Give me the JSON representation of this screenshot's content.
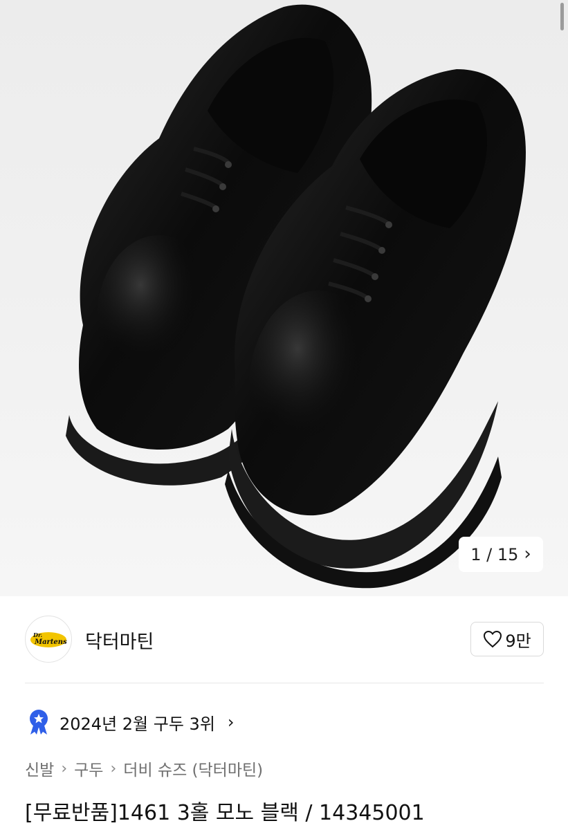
{
  "gallery": {
    "current": "1",
    "total": "15",
    "counter_text": "1 / 15",
    "next_icon": "chevron-right-icon"
  },
  "brand": {
    "name": "닥터마틴",
    "logo_icon": "brand-logo-icon",
    "like_count": "9만",
    "like_icon": "heart-outline-icon"
  },
  "ranking": {
    "icon": "award-badge-icon",
    "text": "2024년 2월 구두 3위",
    "chev_icon": "chevron-right-icon"
  },
  "breadcrumb": {
    "items": [
      "신발",
      "구두",
      "더비 슈즈 (닥터마틴)"
    ]
  },
  "product": {
    "title": "[무료반품]1461 3홀 모노 블랙 / 14345001"
  },
  "colors": {
    "badge_blue": "#2f5fe8",
    "text_primary": "#111111",
    "text_secondary": "#6f6f6f",
    "divider": "#e6e6e6"
  }
}
